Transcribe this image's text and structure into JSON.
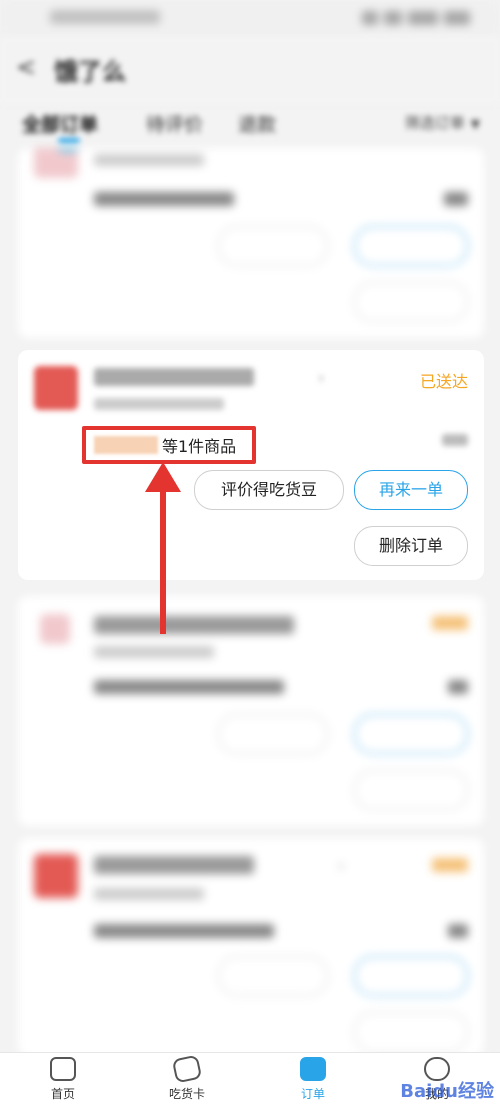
{
  "header": {
    "back": "<",
    "title": "饿了么"
  },
  "tabs": {
    "items": [
      "全部订单",
      "待评价",
      "退款"
    ],
    "filter": "筛选订单"
  },
  "focused_order": {
    "status": "已送达",
    "items_text": "等1件商品",
    "buttons": [
      "评价得吃货豆",
      "再来一单",
      "删除订单"
    ]
  },
  "blurred_orders": [
    {
      "shop": "",
      "items": "",
      "price": "",
      "buttons": [
        "",
        "",
        ""
      ]
    },
    {
      "shop": "",
      "items": "",
      "price": "",
      "buttons": [
        "",
        "",
        ""
      ]
    },
    {
      "shop": "",
      "items": "",
      "price": "",
      "buttons": [
        "",
        "",
        ""
      ]
    }
  ],
  "bottom_nav": [
    {
      "label": "首页",
      "icon": "home-icon"
    },
    {
      "label": "吃货卡",
      "icon": "card-icon"
    },
    {
      "label": "订单",
      "icon": "order-icon",
      "active": true
    },
    {
      "label": "我的",
      "icon": "profile-icon"
    }
  ],
  "watermark": "Baidu经验",
  "colors": {
    "accent": "#2aa4e8",
    "status": "#f5a623",
    "highlight": "#e3342f"
  }
}
